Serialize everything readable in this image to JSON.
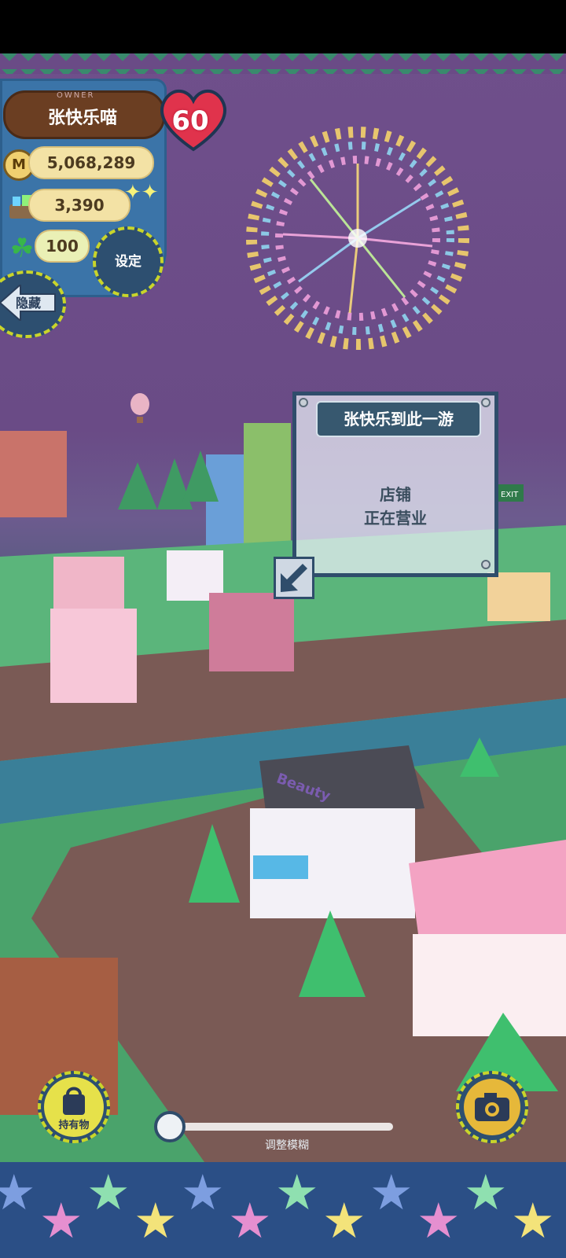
{
  "owner": {
    "label": "OWNER",
    "name": "张快乐喵",
    "level": "60"
  },
  "stats": {
    "coins": "5,068,289",
    "coin_symbol": "M",
    "gems": "3,390",
    "clovers": "100"
  },
  "buttons": {
    "settings": "设定",
    "hide": "隐藏",
    "items": "持有物"
  },
  "popup": {
    "title": "张快乐到此一游",
    "line1": "店铺",
    "line2": "正在营业"
  },
  "blur_slider": {
    "label": "调整模糊",
    "value": 0
  },
  "scene_signs": {
    "beauty": "Beauty",
    "exit": "EXIT"
  },
  "colors": {
    "sky": "#6a4b86",
    "panel_blue": "#3b74a8",
    "accent_yellow": "#c9d52a",
    "heart_red": "#e0334c"
  }
}
